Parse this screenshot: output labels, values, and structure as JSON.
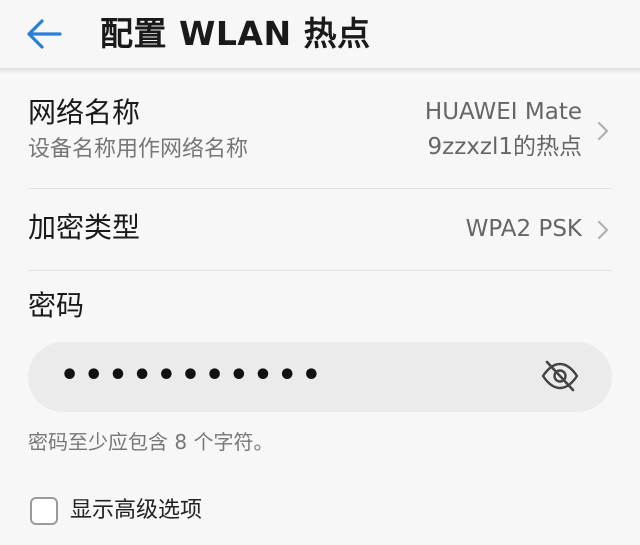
{
  "header": {
    "title": "配置 WLAN 热点",
    "back_icon": "back-arrow-icon",
    "accent_color": "#2a7ed6"
  },
  "network_name": {
    "label": "网络名称",
    "subtitle": "设备名称用作网络名称",
    "value_line1": "HUAWEI Mate",
    "value_line2": "9zzxzl1的热点"
  },
  "encryption": {
    "label": "加密类型",
    "value": "WPA2 PSK"
  },
  "password": {
    "label": "密码",
    "masked_value": "•••••••••••",
    "toggle_icon": "eye-off-icon",
    "hint": "密码至少应包含 8 个字符。"
  },
  "advanced": {
    "label": "显示高级选项",
    "checked": false
  }
}
